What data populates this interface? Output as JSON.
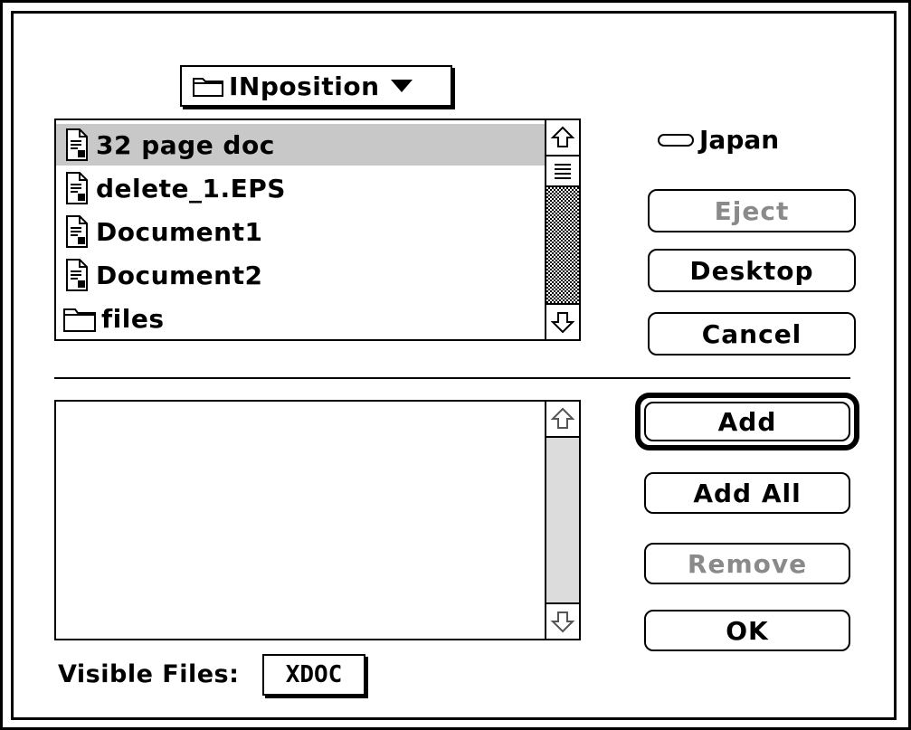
{
  "folder_popup": {
    "label": "INposition",
    "icon": "folder-icon"
  },
  "file_list": {
    "items": [
      {
        "name": "32 page doc",
        "icon": "document-icon",
        "selected": true
      },
      {
        "name": "delete_1.EPS",
        "icon": "document-icon",
        "selected": false
      },
      {
        "name": "Document1",
        "icon": "document-icon",
        "selected": false
      },
      {
        "name": "Document2",
        "icon": "document-icon",
        "selected": false
      },
      {
        "name": "files",
        "icon": "folder-icon",
        "selected": false
      }
    ]
  },
  "drive": {
    "label": "Japan",
    "icon": "drive-icon"
  },
  "buttons": {
    "eject": "Eject",
    "desktop": "Desktop",
    "cancel": "Cancel",
    "add": "Add",
    "add_all": "Add All",
    "remove": "Remove",
    "ok": "OK"
  },
  "added_list": {
    "items": []
  },
  "visible_files": {
    "label": "Visible Files:",
    "value": "XDOC"
  },
  "colors": {
    "selection": "#c8c8c8",
    "disabled_text": "#8a8a8a"
  }
}
